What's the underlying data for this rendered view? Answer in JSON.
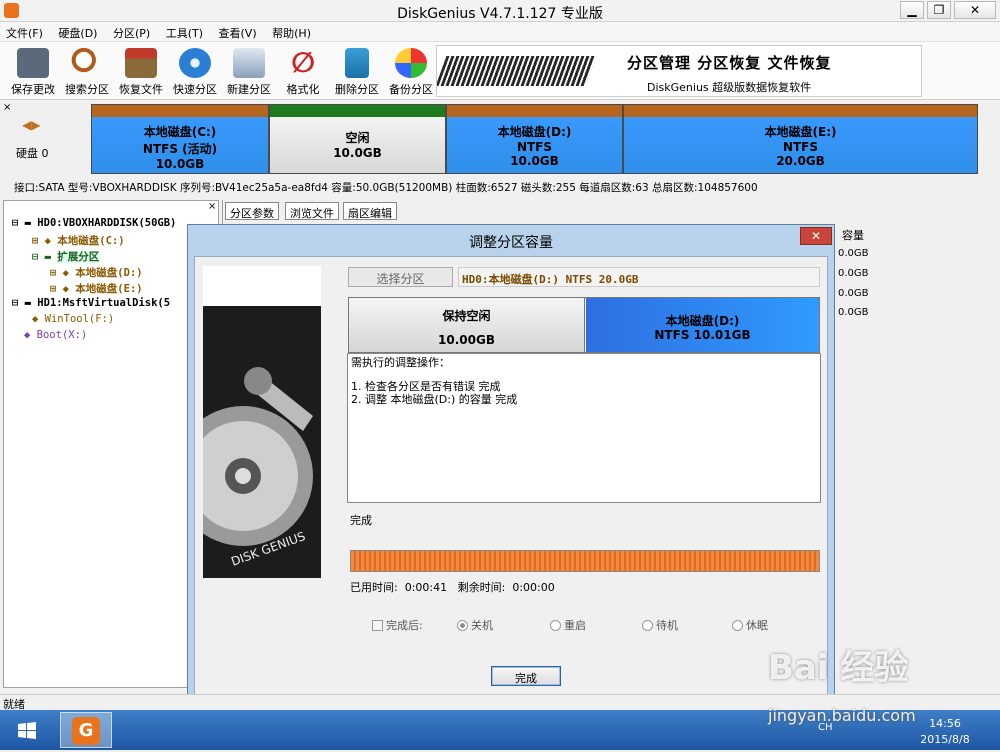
{
  "app": {
    "title": "DiskGenius V4.7.1.127 专业版"
  },
  "menu": [
    "文件(F)",
    "硬盘(D)",
    "分区(P)",
    "工具(T)",
    "查看(V)",
    "帮助(H)"
  ],
  "toolbar": [
    "保存更改",
    "搜索分区",
    "恢复文件",
    "快速分区",
    "新建分区",
    "格式化",
    "删除分区",
    "备份分区"
  ],
  "banner": {
    "line1": "分区管理 分区恢复 文件恢复",
    "line2": "DiskGenius 超级版数据恢复软件"
  },
  "diskmap": {
    "disk_label": "硬盘 0",
    "partitions": [
      {
        "name": "本地磁盘(C:)",
        "fs": "NTFS (活动)",
        "size": "10.0GB"
      },
      {
        "name": "空闲",
        "fs": "",
        "size": "10.0GB"
      },
      {
        "name": "本地磁盘(D:)",
        "fs": "NTFS",
        "size": "10.0GB"
      },
      {
        "name": "本地磁盘(E:)",
        "fs": "NTFS",
        "size": "20.0GB"
      }
    ]
  },
  "infoline": "接口:SATA  型号:VBOXHARDDISK  序列号:BV41ec25a5a-ea8fd4  容量:50.0GB(51200MB)  柱面数:6527  磁头数:255  每道扇区数:63  总扇区数:104857600",
  "tree": {
    "items": [
      "HD0:VBOXHARDDISK(50GB)",
      "本地磁盘(C:)",
      "扩展分区",
      "本地磁盘(D:)",
      "本地磁盘(E:)",
      "HD1:MsftVirtualDisk(5",
      "WinTool(F:)",
      "Boot(X:)"
    ]
  },
  "tabs": [
    "分区参数",
    "浏览文件",
    "扇区编辑"
  ],
  "rightcol": {
    "header": "容量",
    "values": [
      "0.0GB",
      "0.0GB",
      "0.0GB",
      "0.0GB"
    ]
  },
  "dialog": {
    "title": "调整分区容量",
    "close": "✕",
    "select_button": "选择分区",
    "path": "HD0:本地磁盘(D:) NTFS 20.0GB",
    "left_part": {
      "name": "保持空闲",
      "size": "10.00GB"
    },
    "right_part": {
      "name": "本地磁盘(D:)",
      "fs": "NTFS 10.01GB"
    },
    "log_title": "需执行的调整操作：",
    "log_lines": [
      "1. 检查各分区是否有错误    完成",
      "2. 调整 本地磁盘(D:) 的容量    完成"
    ],
    "status": "完成",
    "progress": 1.0,
    "used_time_label": "已用时间:",
    "used_time": "0:00:41",
    "remain_time_label": "剩余时间:",
    "remain_time": "0:00:00",
    "after_label": "完成后:",
    "options": [
      "关机",
      "重启",
      "待机",
      "休眠"
    ],
    "done_button": "完成"
  },
  "status": "就绪",
  "taskbar": {
    "clock_time": "14:56",
    "clock_date": "2015/8/8",
    "ime": "CH"
  },
  "watermark": {
    "text": "Bai 经验",
    "url": "jingyan.baidu.com"
  },
  "colors": {
    "partition_blue": "#2f8fea",
    "free_gray": "#e0e0e0",
    "partition_top": "#b5651d",
    "progress_orange": "#f08a40"
  }
}
